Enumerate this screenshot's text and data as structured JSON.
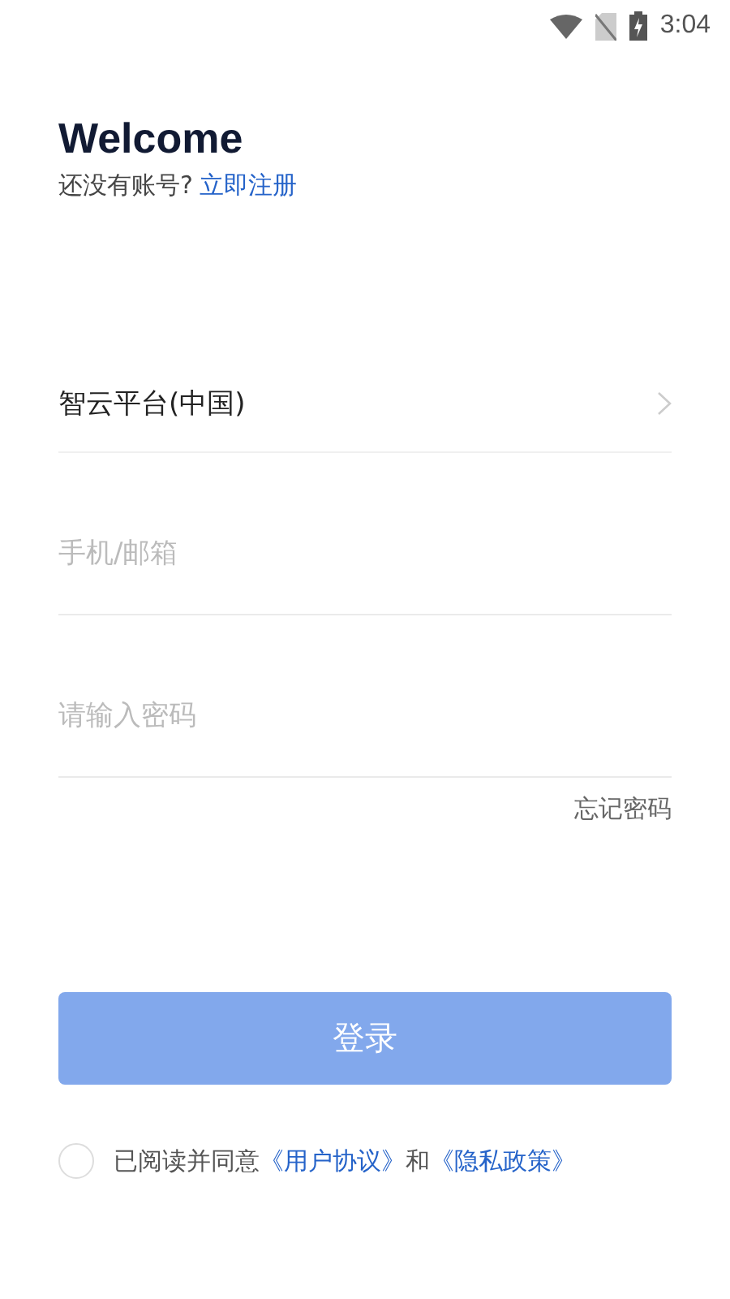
{
  "status_bar": {
    "time": "3:04"
  },
  "header": {
    "title": "Welcome",
    "prompt": "还没有账号?",
    "register_link": "立即注册"
  },
  "platform": {
    "value": "智云平台(中国)"
  },
  "phone_field": {
    "placeholder": "手机/邮箱"
  },
  "password_field": {
    "placeholder": "请输入密码"
  },
  "forgot_link": "忘记密码",
  "login_button": {
    "label": "登录",
    "disabled": true
  },
  "agreement": {
    "checked": false,
    "parts": [
      {
        "kind": "text",
        "text": "已阅读并同意"
      },
      {
        "kind": "link",
        "text": "《用户协议》"
      },
      {
        "kind": "text",
        "text": "和"
      },
      {
        "kind": "link",
        "text": "《隐私政策》"
      }
    ]
  }
}
